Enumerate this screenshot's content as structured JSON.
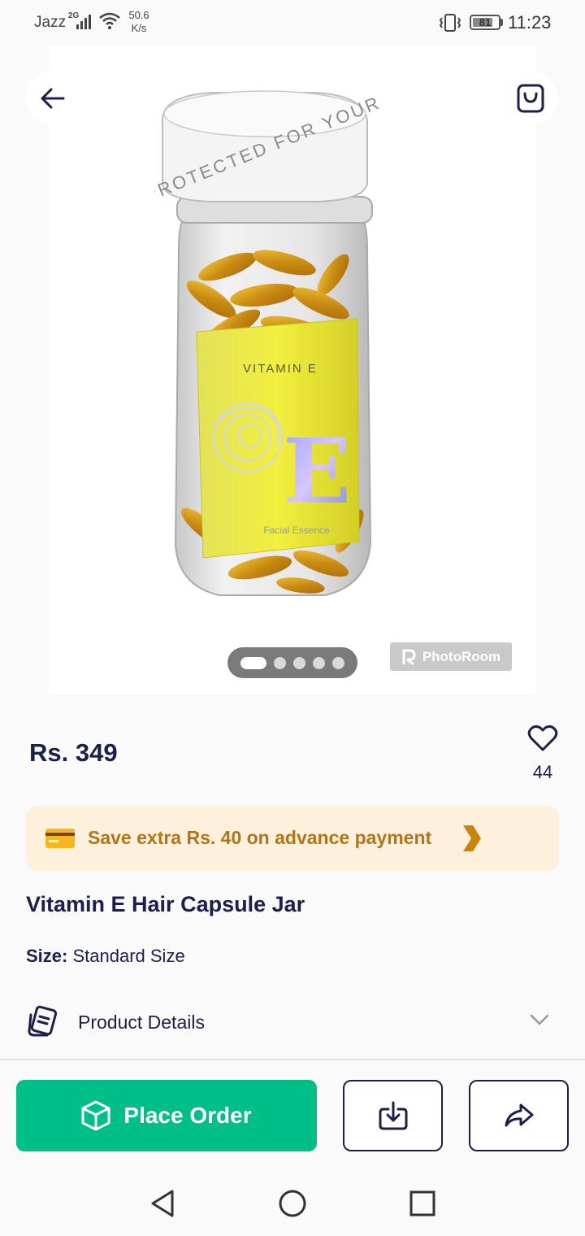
{
  "status_bar": {
    "carrier": "Jazz",
    "network": "2G",
    "speed_value": "50.6",
    "speed_unit": "K/s",
    "battery": "81",
    "time": "11:23"
  },
  "gallery": {
    "image_count": 5,
    "active_index": 0,
    "watermark": "PhotoRoom",
    "label_text_top": "VITAMIN E",
    "label_big_letter": "E",
    "label_subtext": "Facial Essence",
    "cap_text": "PROTECTED FOR YOUR"
  },
  "product": {
    "price": "Rs. 349",
    "wishlist_count": "44",
    "title": "Vitamin E Hair Capsule Jar",
    "size_label": "Size:",
    "size_value": "Standard Size"
  },
  "offer": {
    "text": "Save extra Rs. 40 on advance payment"
  },
  "details": {
    "label": "Product Details"
  },
  "actions": {
    "place_order": "Place Order"
  },
  "colors": {
    "primary": "#00bf86",
    "navy": "#1b1f4a",
    "offer_bg": "#fdf0dd",
    "offer_text": "#b07519"
  },
  "icons": {
    "back": "arrow-left-icon",
    "bag": "shopping-bag-icon",
    "wishlist": "heart-icon",
    "card": "credit-card-icon",
    "offer_arrow": "chevron-right-icon",
    "details": "document-icon",
    "details_toggle": "chevron-down-icon",
    "place_order": "box-icon",
    "download": "download-icon",
    "share": "share-icon"
  }
}
